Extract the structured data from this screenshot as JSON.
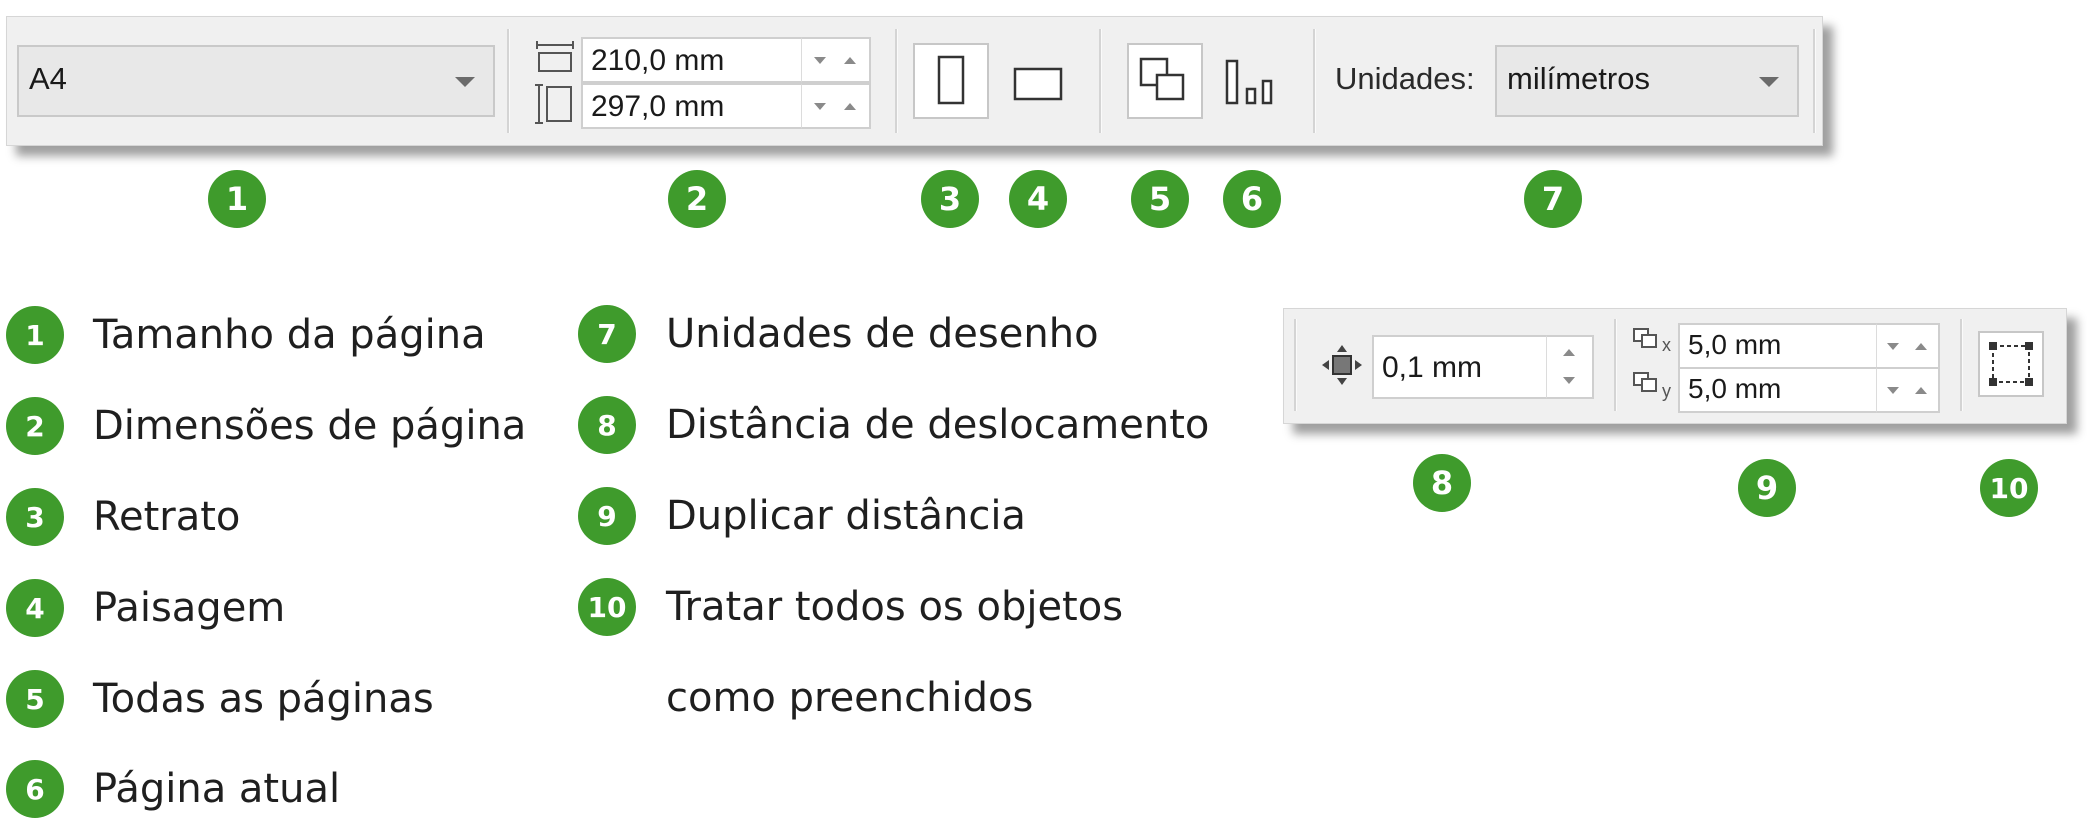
{
  "toolbar1": {
    "page_size": {
      "value": "A4"
    },
    "width_field": {
      "value": "210,0 mm"
    },
    "height_field": {
      "value": "297,0 mm"
    },
    "units_label": "Unidades:",
    "units_select": {
      "value": "milímetros"
    }
  },
  "toolbar2": {
    "nudge_field": {
      "value": "0,1 mm"
    },
    "dup_x": {
      "value": "5,0 mm"
    },
    "dup_y": {
      "value": "5,0 mm"
    },
    "dup_x_sub": "x",
    "dup_y_sub": "y"
  },
  "badges": [
    "1",
    "2",
    "3",
    "4",
    "5",
    "6",
    "7",
    "8",
    "9",
    "10"
  ],
  "legend": [
    {
      "num": "1",
      "text": "Tamanho da página"
    },
    {
      "num": "2",
      "text": "Dimensões de página"
    },
    {
      "num": "3",
      "text": "Retrato"
    },
    {
      "num": "4",
      "text": "Paisagem"
    },
    {
      "num": "5",
      "text": "Todas as páginas"
    },
    {
      "num": "6",
      "text": "Página atual"
    },
    {
      "num": "7",
      "text": "Unidades de desenho"
    },
    {
      "num": "8",
      "text": "Distância de deslocamento"
    },
    {
      "num": "9",
      "text": "Duplicar distância"
    },
    {
      "num": "10",
      "text": "Tratar todos os objetos"
    },
    {
      "num": "",
      "text": "como preenchidos"
    }
  ],
  "colors": {
    "badge": "#3f9b2c",
    "toolbar_bg": "#f0f0f0"
  },
  "icons": {
    "width_icon": "page-width-icon",
    "height_icon": "page-height-icon",
    "portrait": "portrait-icon",
    "landscape": "landscape-icon",
    "all_pages": "all-pages-icon",
    "current_page": "current-page-icon",
    "nudge": "nudge-icon",
    "duplicate_x": "duplicate-x-icon",
    "duplicate_y": "duplicate-y-icon",
    "treat_filled": "treat-as-filled-icon"
  }
}
